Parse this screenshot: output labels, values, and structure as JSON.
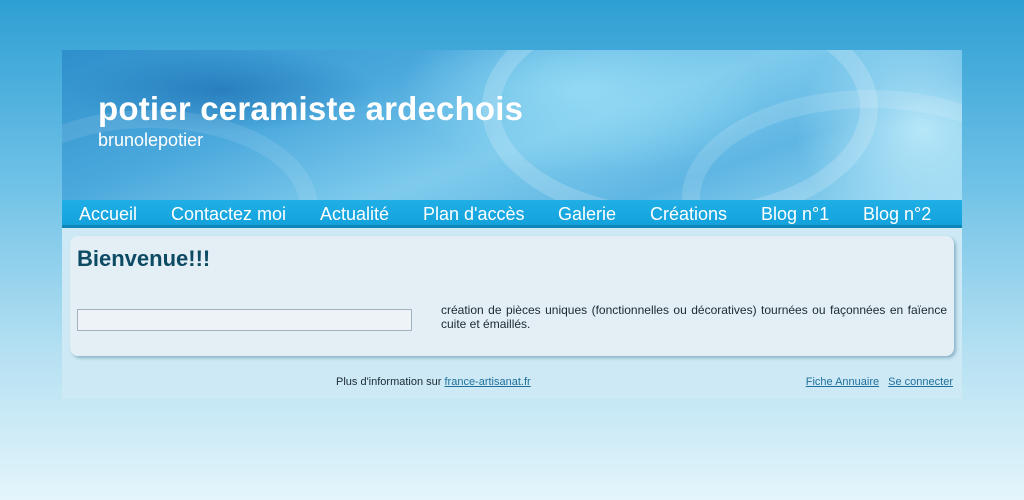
{
  "header": {
    "title": "potier ceramiste ardechois",
    "subtitle": "brunolepotier"
  },
  "nav": {
    "items": [
      {
        "label": "Accueil"
      },
      {
        "label": "Contactez moi"
      },
      {
        "label": "Actualité"
      },
      {
        "label": "Plan d'accès"
      },
      {
        "label": "Galerie"
      },
      {
        "label": "Créations"
      },
      {
        "label": "Blog n°1"
      },
      {
        "label": "Blog n°2"
      }
    ]
  },
  "main": {
    "heading": "Bienvenue!!!",
    "description": "création de pièces uniques (fonctionnelles ou décoratives) tournées ou façonnées en faïence cuite et émaillés."
  },
  "footer": {
    "info_text": "Plus d'information sur ",
    "info_link": "france-artisanat.fr",
    "links": [
      {
        "label": "Fiche Annuaire"
      },
      {
        "label": "Se connecter"
      }
    ]
  },
  "colors": {
    "nav_bar": "#13a2dc",
    "heading": "#0d4a63",
    "link": "#1f6f9b",
    "content_bg": "#e3eef5"
  }
}
